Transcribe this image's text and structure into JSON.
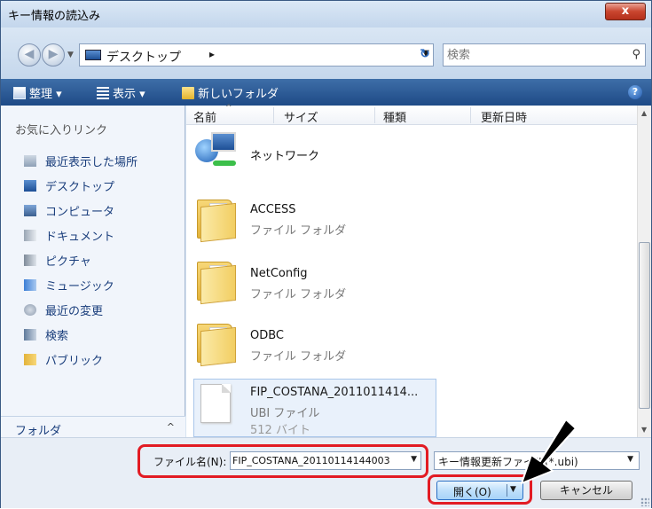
{
  "window": {
    "title": "キー情報の読込み",
    "close_label": "x"
  },
  "address": {
    "location": "デスクトップ",
    "chevron": "▸"
  },
  "search": {
    "placeholder": "検索"
  },
  "toolbar": {
    "organize": "整理 ▾",
    "view": "表示 ▾",
    "new_folder": "新しいフォルダ",
    "help": "?"
  },
  "sidebar": {
    "heading": "お気に入りリンク",
    "items": [
      {
        "label": "最近表示した場所",
        "icon": "recent-places-icon"
      },
      {
        "label": "デスクトップ",
        "icon": "desktop-icon"
      },
      {
        "label": "コンピュータ",
        "icon": "computer-icon"
      },
      {
        "label": "ドキュメント",
        "icon": "documents-icon"
      },
      {
        "label": "ピクチャ",
        "icon": "pictures-icon"
      },
      {
        "label": "ミュージック",
        "icon": "music-icon"
      },
      {
        "label": "最近の変更",
        "icon": "recent-changes-icon"
      },
      {
        "label": "検索",
        "icon": "search-folder-icon"
      },
      {
        "label": "パブリック",
        "icon": "public-folder-icon"
      }
    ],
    "folders_label": "フォルダ",
    "folders_caret": "^"
  },
  "columns": {
    "name": "名前",
    "size": "サイズ",
    "type": "種類",
    "modified": "更新日時"
  },
  "files": [
    {
      "name": "ネットワーク",
      "type": "",
      "size": "",
      "icon": "network-icon"
    },
    {
      "name": "ACCESS",
      "type": "ファイル フォルダ",
      "size": "",
      "icon": "folder-icon"
    },
    {
      "name": "NetConfig",
      "type": "ファイル フォルダ",
      "size": "",
      "icon": "folder-icon"
    },
    {
      "name": "ODBC",
      "type": "ファイル フォルダ",
      "size": "",
      "icon": "folder-icon"
    },
    {
      "name": "FIP_COSTANA_2011011414...",
      "type": "UBI ファイル",
      "size": "512 バイト",
      "icon": "file-icon"
    }
  ],
  "bottom": {
    "filename_label": "ファイル名(N):",
    "filename_value": "FIP_COSTANA_20110114144003",
    "filetype_value": "キー情報更新ファイル(*.ubi)",
    "open_label": "開く(O)",
    "cancel_label": "キャンセル"
  },
  "colors": {
    "highlight": "#e21b23",
    "toolbar": "#2b5a96",
    "arrow": "#000000"
  }
}
